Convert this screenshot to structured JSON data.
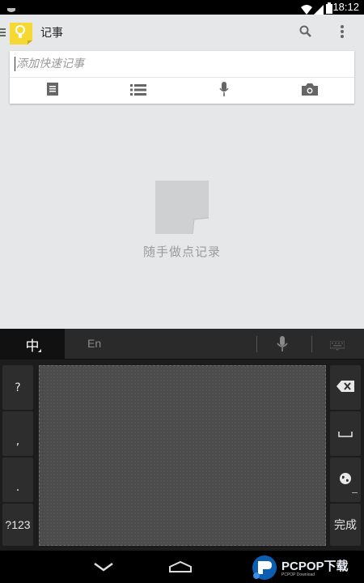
{
  "status_bar": {
    "time": "18:12",
    "icons": [
      "notification-icon",
      "wifi-icon",
      "signal-icon",
      "battery-icon"
    ]
  },
  "action_bar": {
    "title": "记事",
    "icons": [
      "menu-icon",
      "app-logo-icon",
      "search-icon",
      "overflow-menu-icon"
    ]
  },
  "note_card": {
    "placeholder": "添加快速记事",
    "value": "",
    "tools": [
      "text-note-icon",
      "list-icon",
      "microphone-icon",
      "camera-icon"
    ]
  },
  "empty_state": {
    "text": "随手做点记录",
    "icon": "note-page-icon"
  },
  "keyboard": {
    "lang_zh": "中",
    "lang_en": "En",
    "left_keys": [
      "?",
      ",",
      ".",
      "?123"
    ],
    "right_keys": [
      "backspace-icon",
      "space-icon",
      "globe-icon",
      "完成"
    ],
    "colors": {
      "background": "#1c1c1c",
      "pad": "#4b4b4b",
      "key": "#2d2d2d"
    }
  },
  "nav_bar": {
    "icons": [
      "back-icon",
      "home-icon"
    ]
  },
  "watermark": {
    "text": "PCPOP下载",
    "sub": "PCPOP Download"
  },
  "colors": {
    "app_bg": "#e6e7e8",
    "logo_yellow": "#f5d932",
    "text_secondary": "#9b9b9b"
  }
}
